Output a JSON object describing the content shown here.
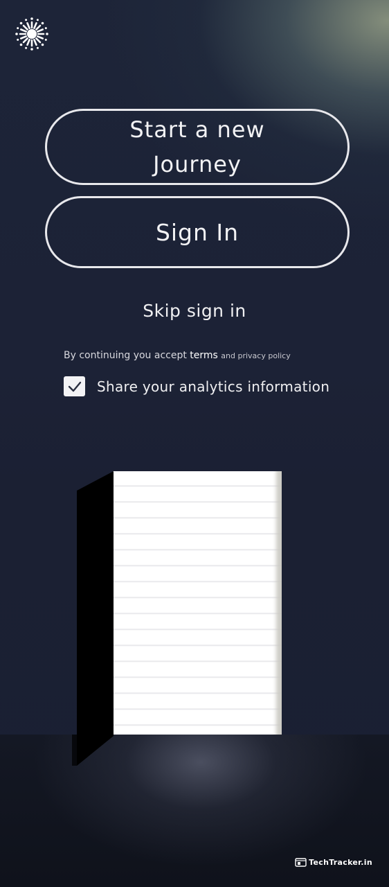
{
  "app": {
    "logo_icon": "sunburst-logo-icon"
  },
  "actions": {
    "start_journey_label": "Start a new Journey",
    "sign_in_label": "Sign In",
    "skip_label": "Skip sign in"
  },
  "legal": {
    "prefix": "By continuing you accept",
    "terms_link": "terms",
    "privacy_suffix": "and privacy policy"
  },
  "analytics": {
    "label": "Share your analytics information",
    "checked": true
  },
  "illustration": {
    "name": "open-door-illustration"
  },
  "watermark": {
    "text": "TechTracker.in"
  },
  "colors": {
    "background": "#1c2236",
    "accent_glow": "#8f9c86",
    "button_border": "#e8e8ec",
    "text": "#ffffff"
  }
}
